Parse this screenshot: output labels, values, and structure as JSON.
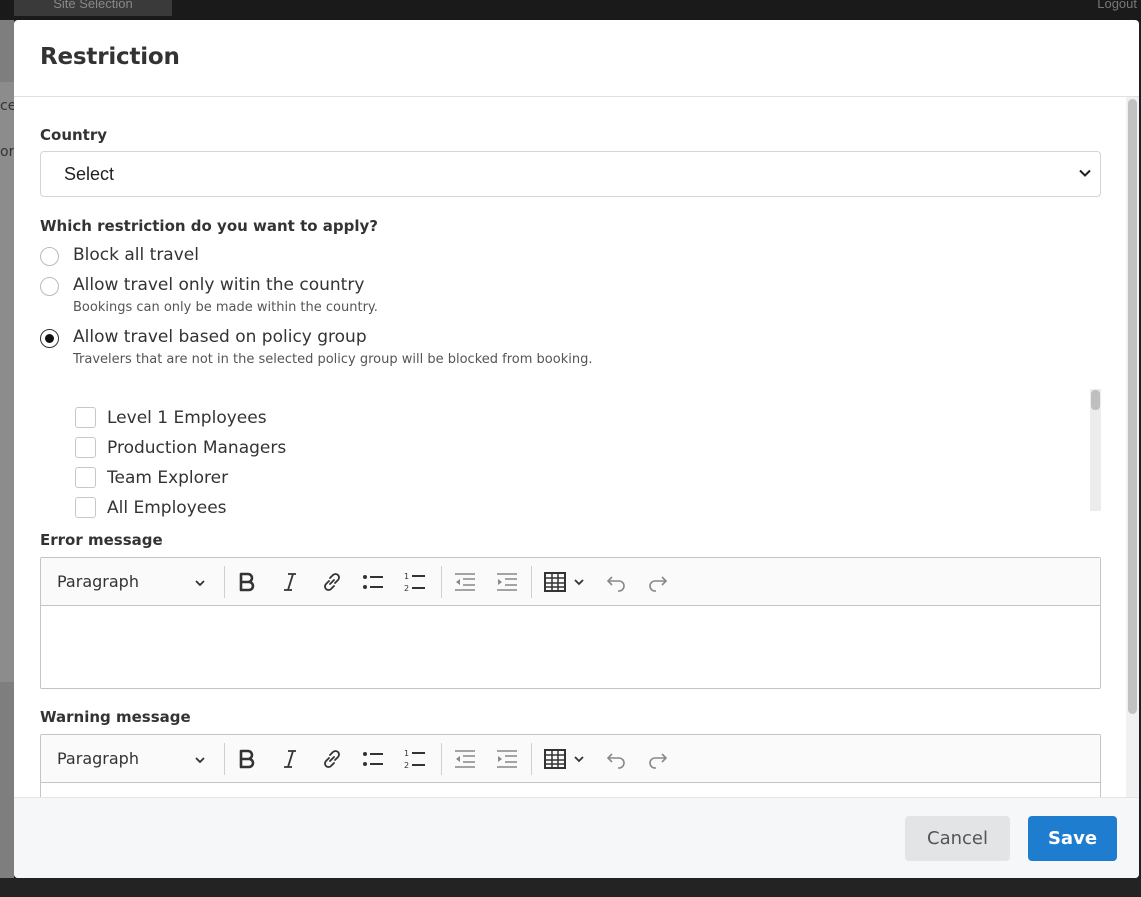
{
  "background": {
    "tab_label": "Site Selection",
    "logout_label": "Logout",
    "left_fragments": [
      "ce",
      "or"
    ]
  },
  "modal": {
    "title": "Restriction",
    "country": {
      "label": "Country",
      "selected": "Select"
    },
    "restriction": {
      "label": "Which restriction do you want to apply?",
      "options": [
        {
          "label": "Block all travel",
          "help": "",
          "checked": false
        },
        {
          "label": "Allow travel only witin the country",
          "help": "Bookings can only be made within the country.",
          "checked": false
        },
        {
          "label": "Allow travel based on policy group",
          "help": "Travelers that are not in the selected policy group will be blocked from booking.",
          "checked": true
        }
      ]
    },
    "policy_groups": [
      {
        "label": "Level 1 Employees",
        "checked": false
      },
      {
        "label": "Production Managers",
        "checked": false
      },
      {
        "label": "Team Explorer",
        "checked": false
      },
      {
        "label": "All Employees",
        "checked": false
      }
    ],
    "error_message": {
      "label": "Error message",
      "format": "Paragraph"
    },
    "warning_message": {
      "label": "Warning message",
      "format": "Paragraph"
    },
    "toolbar_icons": [
      "bold-icon",
      "italic-icon",
      "link-icon",
      "bulleted-list-icon",
      "numbered-list-icon",
      "outdent-icon",
      "indent-icon",
      "table-icon",
      "undo-icon",
      "redo-icon"
    ],
    "footer": {
      "cancel_label": "Cancel",
      "save_label": "Save"
    }
  },
  "colors": {
    "primary": "#1f7dcf",
    "cancel_bg": "#e3e4e6",
    "footer_bg": "#f6f7f9"
  }
}
